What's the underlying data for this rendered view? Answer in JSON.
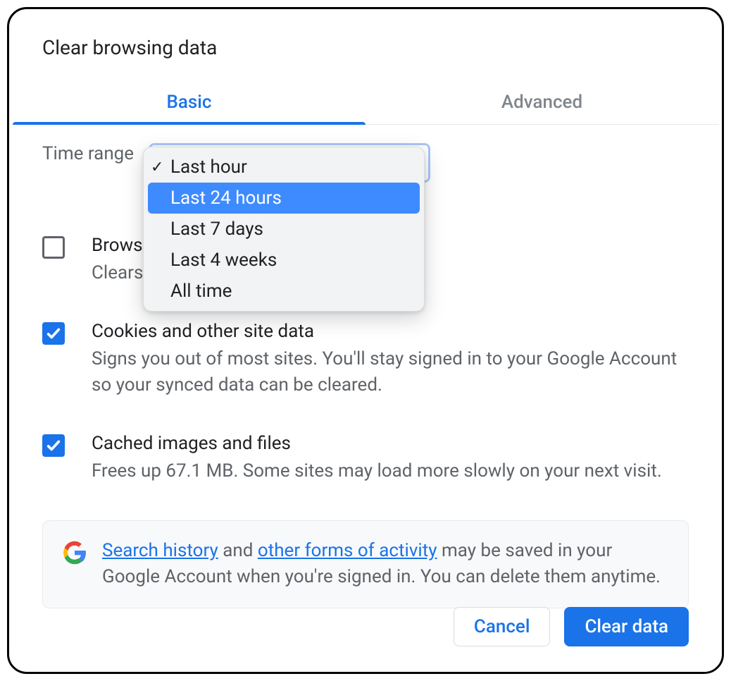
{
  "dialog": {
    "title": "Clear browsing data"
  },
  "tabs": {
    "basic": "Basic",
    "advanced": "Advanced",
    "active": "basic"
  },
  "time_range": {
    "label": "Time range",
    "options": [
      "Last hour",
      "Last 24 hours",
      "Last 7 days",
      "Last 4 weeks",
      "All time"
    ],
    "selected": "Last hour",
    "highlighted": "Last 24 hours"
  },
  "options": {
    "history": {
      "checked": false,
      "title_visible": "Brows",
      "desc_visible": "Clears"
    },
    "cookies": {
      "checked": true,
      "title": "Cookies and other site data",
      "desc": "Signs you out of most sites. You'll stay signed in to your Google Account so your synced data can be cleared."
    },
    "cache": {
      "checked": true,
      "title": "Cached images and files",
      "desc": "Frees up 67.1 MB. Some sites may load more slowly on your next visit."
    }
  },
  "info": {
    "link1": "Search history",
    "mid": " and ",
    "link2": "other forms of activity",
    "rest": " may be saved in your Google Account when you're signed in. You can delete them anytime."
  },
  "buttons": {
    "cancel": "Cancel",
    "clear": "Clear data"
  }
}
